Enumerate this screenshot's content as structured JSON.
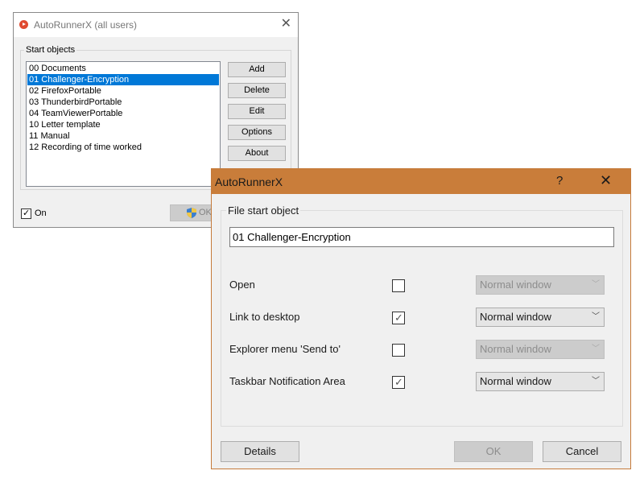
{
  "background_window": {
    "title": "AutoRunnerX (all users)",
    "close_glyph": "✕",
    "group_label": "Start objects",
    "list_items": [
      {
        "label": "00 Documents",
        "selected": false
      },
      {
        "label": "01 Challenger-Encryption",
        "selected": true
      },
      {
        "label": "02 FirefoxPortable",
        "selected": false
      },
      {
        "label": "03 ThunderbirdPortable",
        "selected": false
      },
      {
        "label": "04 TeamViewerPortable",
        "selected": false
      },
      {
        "label": "10 Letter template",
        "selected": false
      },
      {
        "label": "11 Manual",
        "selected": false
      },
      {
        "label": "12 Recording of time worked",
        "selected": false
      }
    ],
    "buttons": {
      "add": "Add",
      "delete": "Delete",
      "edit": "Edit",
      "options": "Options",
      "about": "About"
    },
    "on_checkbox": {
      "label": "On",
      "checked": true,
      "mark": "✓"
    },
    "ok_label": "OK"
  },
  "dialog": {
    "title": "AutoRunnerX",
    "help_glyph": "?",
    "close_glyph": "✕",
    "group_label": "File start object",
    "file_name": "01 Challenger-Encryption",
    "rows": [
      {
        "label": "Open",
        "checked": false,
        "mark": "",
        "window_mode": "Normal window",
        "enabled": false
      },
      {
        "label": "Link to desktop",
        "checked": true,
        "mark": "✓",
        "window_mode": "Normal window",
        "enabled": true
      },
      {
        "label": "Explorer menu 'Send to'",
        "checked": false,
        "mark": "",
        "window_mode": "Normal window",
        "enabled": false
      },
      {
        "label": "Taskbar Notification Area",
        "checked": true,
        "mark": "✓",
        "window_mode": "Normal window",
        "enabled": true
      }
    ],
    "chevron_glyph": "﹀",
    "buttons": {
      "details": "Details",
      "ok": "OK",
      "cancel": "Cancel"
    }
  },
  "colors": {
    "selection": "#0078d7",
    "dialog_titlebar": "#c97d3a"
  }
}
